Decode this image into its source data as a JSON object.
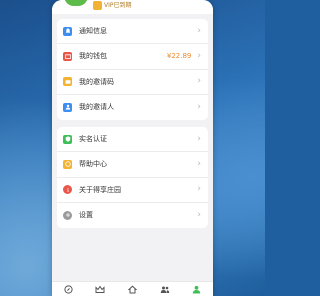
{
  "header": {
    "vip_label": "VIP已到期"
  },
  "section1": [
    {
      "label": "通知信息",
      "value": "",
      "icon": "bell-icon",
      "color": "#3d8ef0"
    },
    {
      "label": "我的钱包",
      "value": "¥22.89",
      "icon": "wallet-icon",
      "color": "#e9574a"
    },
    {
      "label": "我的邀请码",
      "value": "",
      "icon": "ticket-icon",
      "color": "#f2b233"
    },
    {
      "label": "我的邀请人",
      "value": "",
      "icon": "person-icon",
      "color": "#3d8ef0"
    }
  ],
  "section2": [
    {
      "label": "实名认证",
      "icon": "shield-icon",
      "color": "#3fbf5a"
    },
    {
      "label": "帮助中心",
      "icon": "help-icon",
      "color": "#f2b233"
    },
    {
      "label": "关于得享庄园",
      "icon": "info-icon",
      "color": "#e9574a"
    },
    {
      "label": "设置",
      "icon": "gear-icon",
      "color": "#9a9a9a"
    }
  ],
  "navbar": [
    {
      "icon": "compass-icon",
      "color": "#555555"
    },
    {
      "icon": "crown-icon",
      "color": "#555555"
    },
    {
      "icon": "home-icon",
      "color": "#555555"
    },
    {
      "icon": "group-icon",
      "color": "#555555"
    },
    {
      "icon": "profile-icon",
      "color": "#3fbf5a"
    }
  ],
  "chevron": "›"
}
